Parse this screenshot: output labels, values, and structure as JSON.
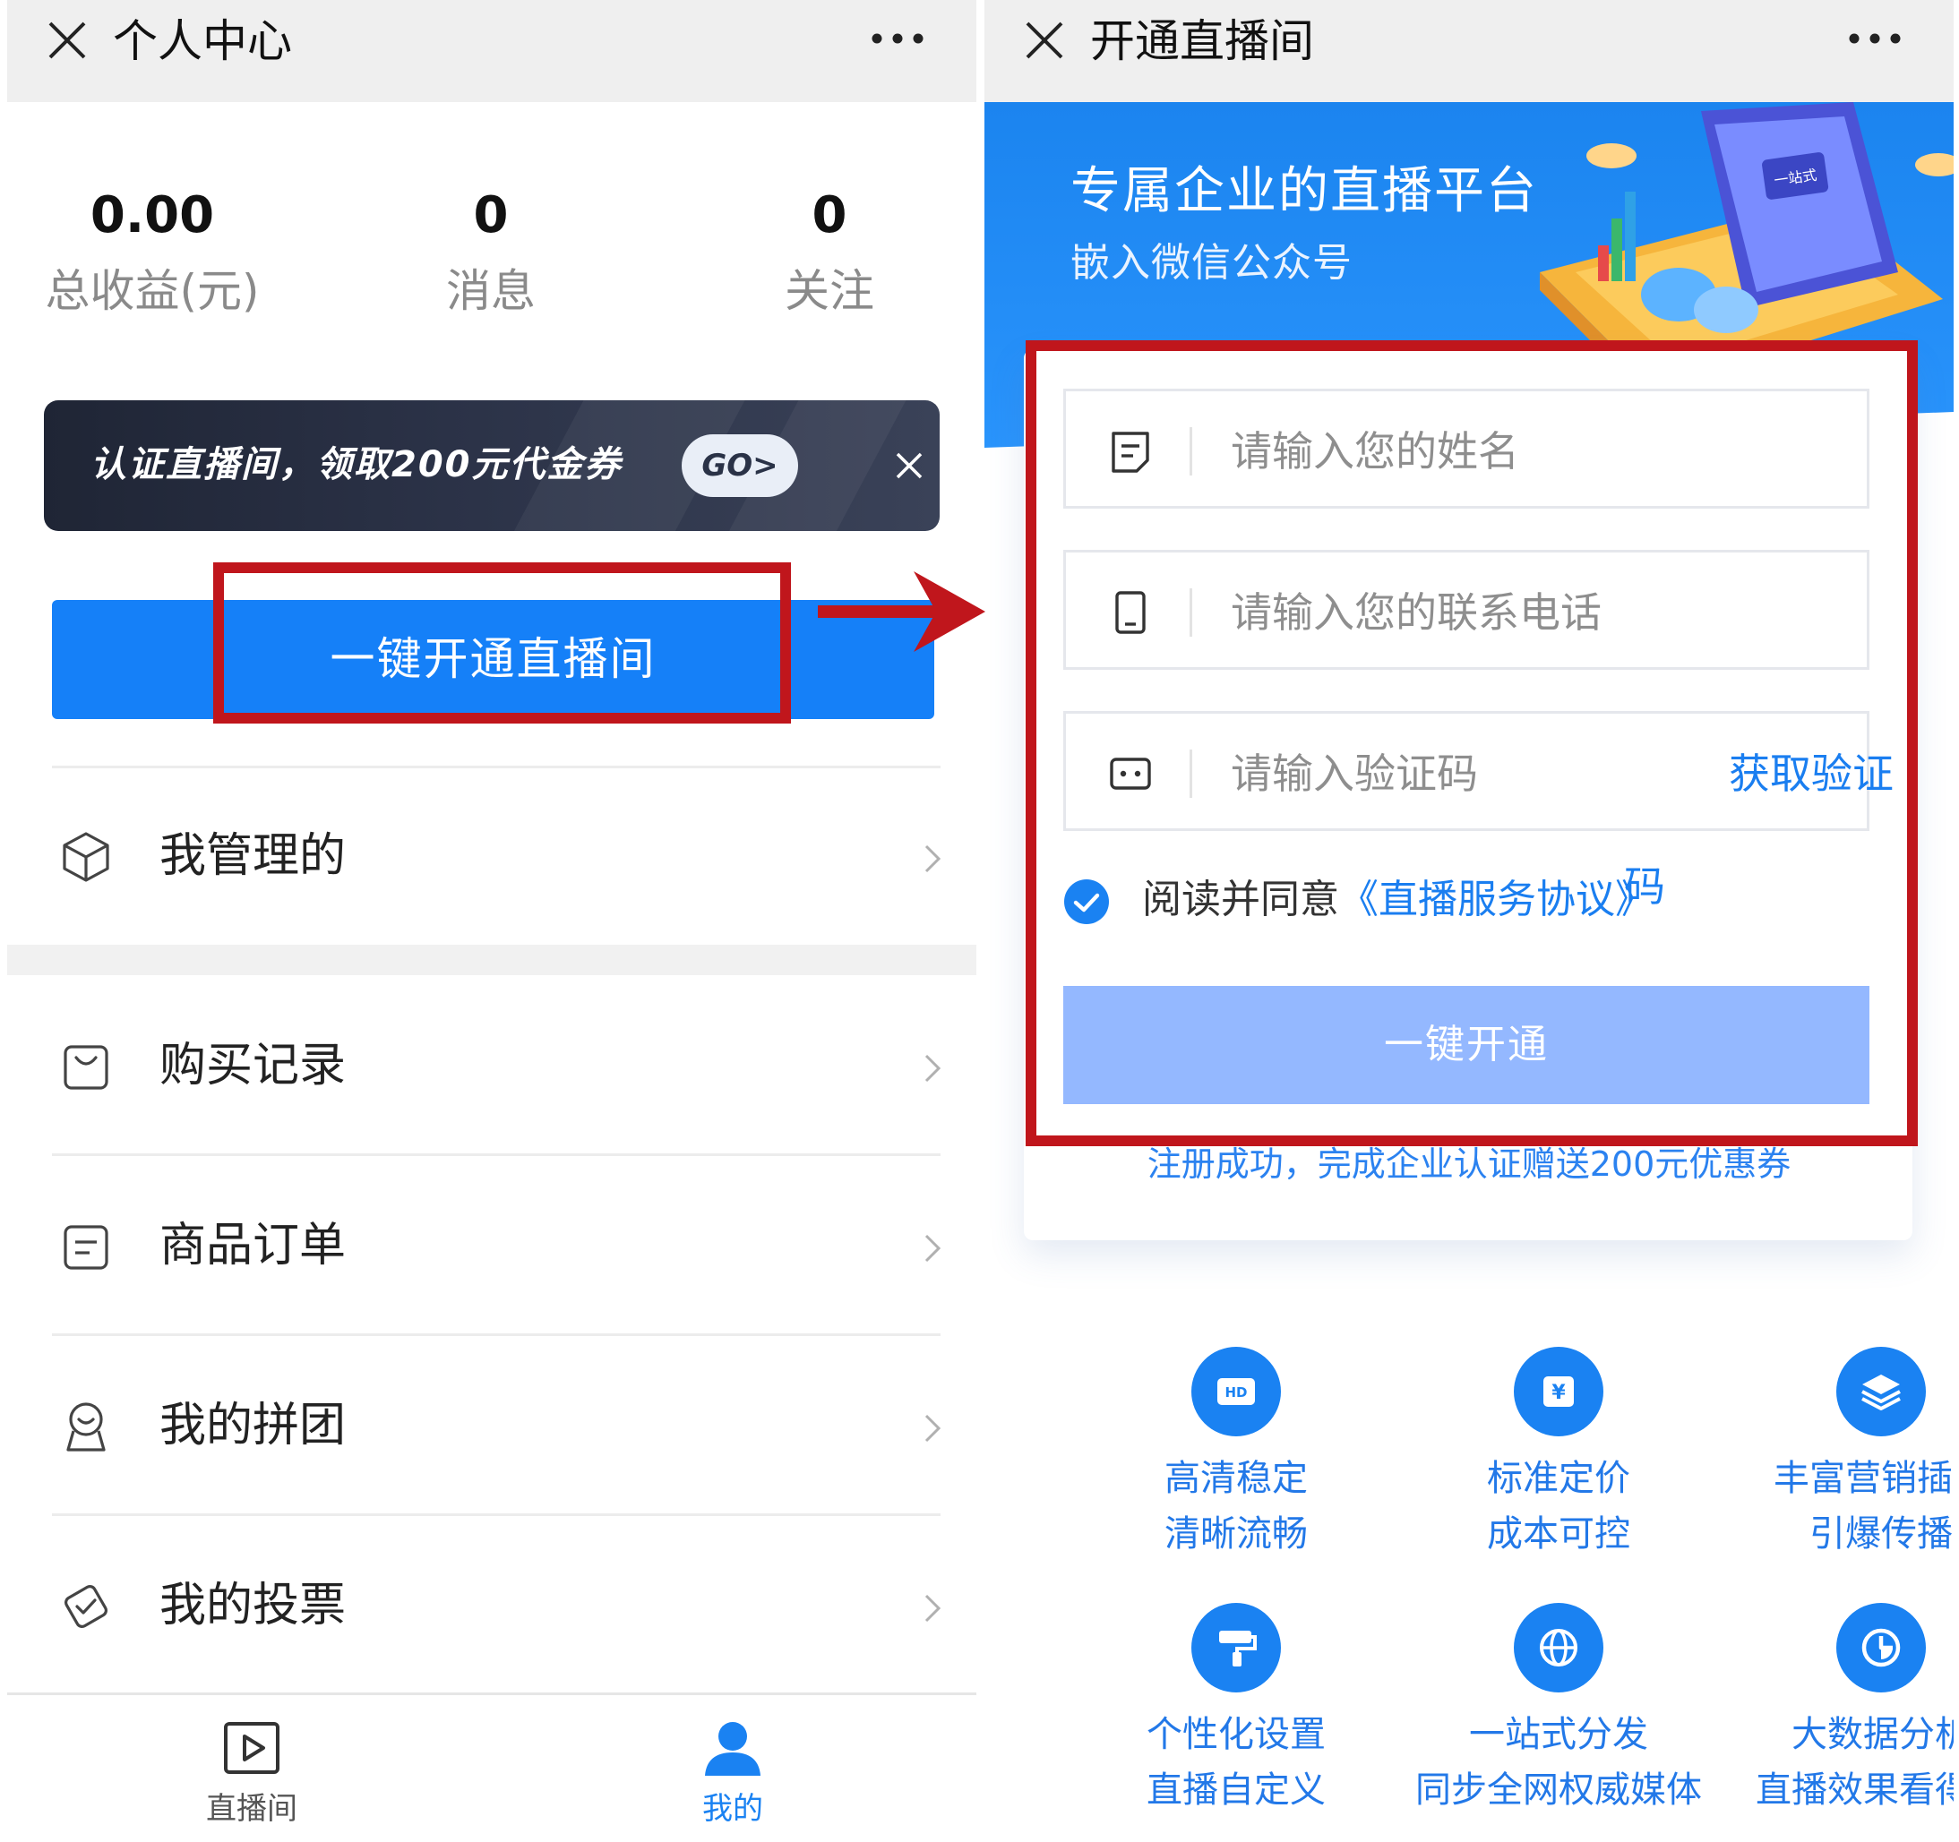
{
  "left": {
    "title": "个人中心",
    "stats": [
      {
        "value": "0.00",
        "label": "总收益(元)"
      },
      {
        "value": "0",
        "label": "消息"
      },
      {
        "value": "0",
        "label": "关注"
      }
    ],
    "banner": {
      "text": "认证直播间，领取200元代金券",
      "go": "GO>"
    },
    "primary_button": "一键开通直播间",
    "menu": [
      {
        "label": "我管理的",
        "icon": "cube-icon"
      },
      {
        "label": "购买记录",
        "icon": "shopping-bag-icon"
      },
      {
        "label": "商品订单",
        "icon": "order-icon"
      },
      {
        "label": "我的拼团",
        "icon": "group-icon"
      },
      {
        "label": "我的投票",
        "icon": "vote-icon"
      }
    ],
    "tabs": [
      {
        "label": "直播间",
        "icon": "play-icon",
        "active": false
      },
      {
        "label": "我的",
        "icon": "user-icon",
        "active": true
      }
    ]
  },
  "right": {
    "title": "开通直播间",
    "hero": {
      "title": "专属企业的直播平台",
      "subtitle": "嵌入微信公众号",
      "screen_text": "一站式"
    },
    "form": {
      "name_placeholder": "请输入您的姓名",
      "phone_placeholder": "请输入您的联系电话",
      "code_placeholder": "请输入验证码",
      "get_code": "获取验证",
      "get_code_tail": "码",
      "agree_text": "阅读并同意",
      "agree_link": "《直播服务协议》",
      "submit": "一键开通"
    },
    "note": "注册成功，完成企业认证赠送200元优惠券",
    "features": [
      {
        "line1": "高清稳定",
        "line2": "清晰流畅",
        "icon": "hd-icon",
        "icon_text": "HD"
      },
      {
        "line1": "标准定价",
        "line2": "成本可控",
        "icon": "price-icon",
        "icon_text": "¥"
      },
      {
        "line1": "丰富营销插件",
        "line2": "引爆传播",
        "icon": "layers-icon"
      },
      {
        "line1": "个性化设置",
        "line2": "直播自定义",
        "icon": "paint-roller-icon"
      },
      {
        "line1": "一站式分发",
        "line2": "同步全网权威媒体",
        "icon": "globe-icon"
      },
      {
        "line1": "大数据分析",
        "line2": "直播效果看得见",
        "icon": "pie-chart-icon"
      }
    ]
  },
  "colors": {
    "primary": "#1580f8",
    "annotation": "#c0161c",
    "submit_disabled": "#94b8ff",
    "link": "#1a7ef0"
  }
}
